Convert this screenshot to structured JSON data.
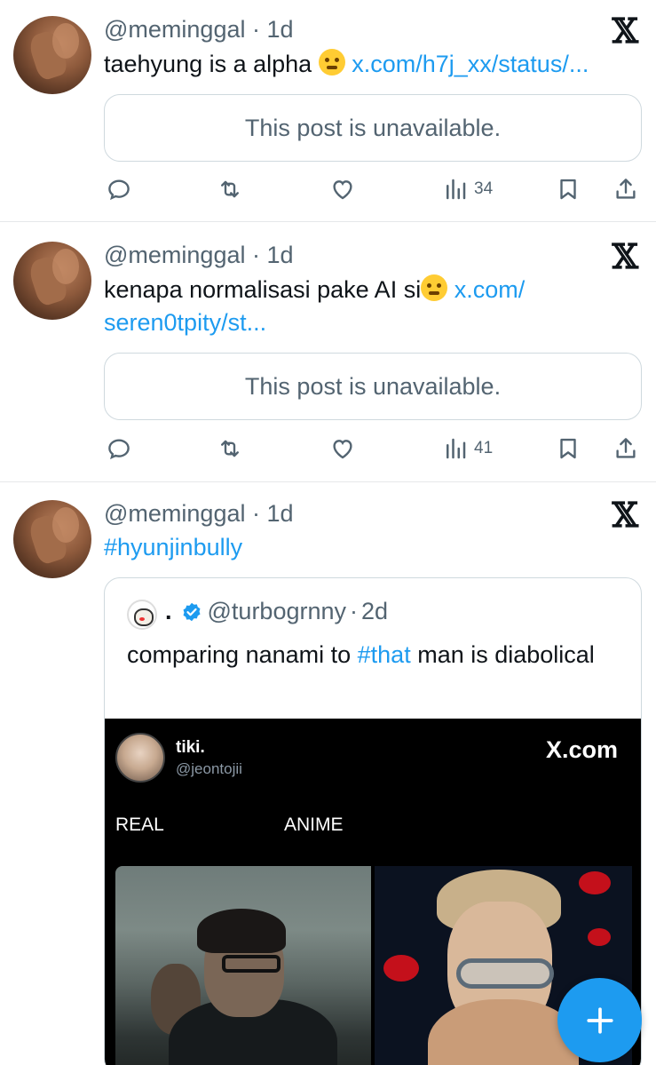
{
  "posts": [
    {
      "handle": "@meminggal",
      "time": "1d",
      "text": "taehyung is a alpha",
      "emoji": "drooling-face-emoji",
      "link": "x.com/h7j_xx/status/...",
      "unavailable": "This post is unavailable.",
      "views": "34"
    },
    {
      "handle": "@meminggal",
      "time": "1d",
      "text": "kenapa normalisasi pake AI si",
      "emoji": "flushed-face-emoji",
      "link_part1": "x.com/",
      "link_part2": "seren0tpity/st...",
      "unavailable": "This post is unavailable.",
      "views": "41"
    },
    {
      "handle": "@meminggal",
      "time": "1d",
      "hashtag": "#hyunjinbully",
      "quote": {
        "name": ".",
        "handle": "@turbogrnny",
        "time": "2d",
        "text_before": "comparing nanami to ",
        "hashtag": "#that",
        "text_after": " man is diabolical",
        "media": {
          "name": "tiki.",
          "handle": "@jeontojii",
          "brand": "X.com",
          "label_left": "REAL",
          "label_right": "ANIME"
        }
      }
    }
  ],
  "separator": "·",
  "icons": {
    "reply": "reply-icon",
    "repost": "repost-icon",
    "like": "like-icon",
    "views": "views-icon",
    "bookmark": "bookmark-icon",
    "share": "share-icon",
    "x_logo": "x-logo-icon",
    "compose": "compose-plus-icon"
  },
  "colors": {
    "accent": "#1d9bf0",
    "text": "#0f1419",
    "muted": "#536471",
    "border": "#cfd9de"
  }
}
